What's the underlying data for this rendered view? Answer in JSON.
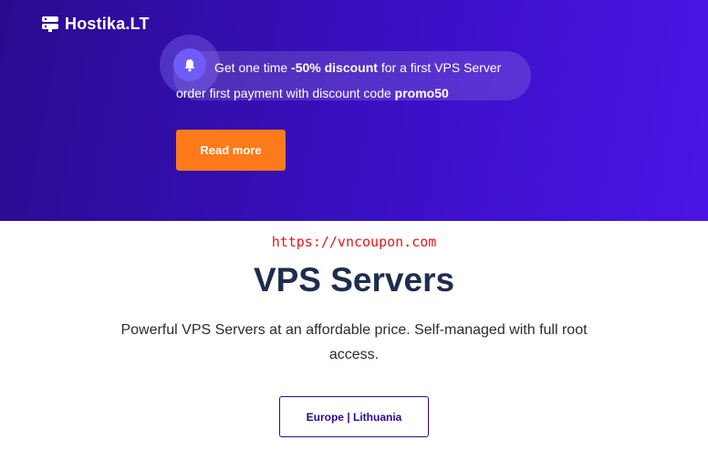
{
  "brand": {
    "name": "Hostika.LT",
    "logo_icon": "server-stack-icon"
  },
  "promo": {
    "icon": "bell-icon",
    "text_pre": "Get one time ",
    "discount": "-50% discount",
    "text_mid": " for a first VPS Server order first payment with discount code ",
    "code": "promo50"
  },
  "hero": {
    "read_more_label": "Read more"
  },
  "watermark": "https://vncoupon.com",
  "main": {
    "title": "VPS Servers",
    "subtitle": "Powerful VPS Servers at an affordable price. Self-managed with full root access.",
    "region_button": "Europe | Lithuania"
  },
  "colors": {
    "hero_start": "#2a0b8f",
    "hero_end": "#4a14e6",
    "accent_orange": "#ff7a1a",
    "title": "#1f2d4d",
    "watermark": "#e8141a"
  }
}
